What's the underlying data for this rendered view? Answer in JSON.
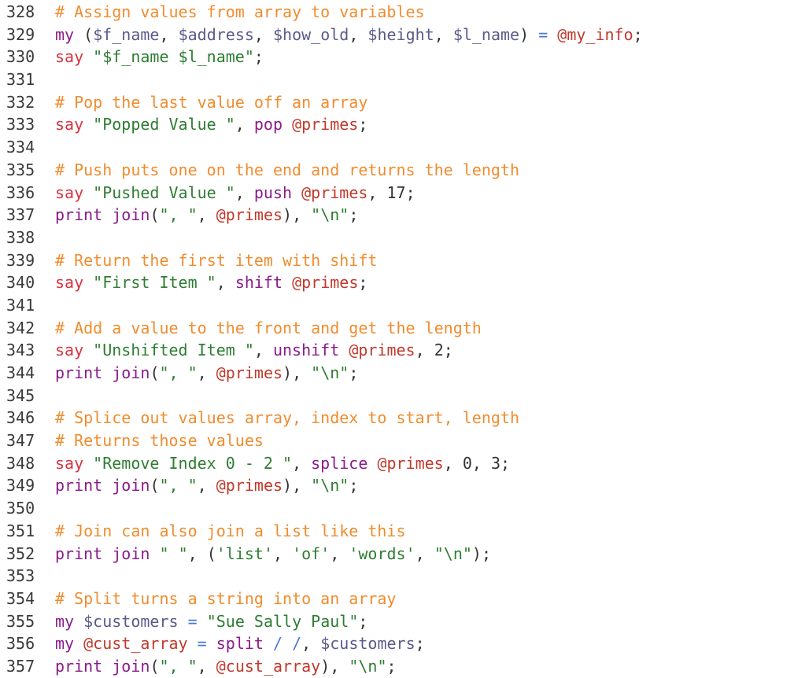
{
  "editor": {
    "lines": [
      {
        "number": "328",
        "tokens": [
          {
            "t": "comment",
            "v": "# Assign values from array to variables"
          }
        ]
      },
      {
        "number": "329",
        "tokens": [
          {
            "t": "keyword",
            "v": "my"
          },
          {
            "t": "plain",
            "v": " ("
          },
          {
            "t": "var",
            "v": "$f_name"
          },
          {
            "t": "plain",
            "v": ", "
          },
          {
            "t": "var",
            "v": "$address"
          },
          {
            "t": "plain",
            "v": ", "
          },
          {
            "t": "var",
            "v": "$how_old"
          },
          {
            "t": "plain",
            "v": ", "
          },
          {
            "t": "var",
            "v": "$height"
          },
          {
            "t": "plain",
            "v": ", "
          },
          {
            "t": "var",
            "v": "$l_name"
          },
          {
            "t": "plain",
            "v": ") "
          },
          {
            "t": "op",
            "v": "="
          },
          {
            "t": "plain",
            "v": " "
          },
          {
            "t": "array",
            "v": "@my_info"
          },
          {
            "t": "plain",
            "v": ";"
          }
        ]
      },
      {
        "number": "330",
        "tokens": [
          {
            "t": "say",
            "v": "say"
          },
          {
            "t": "plain",
            "v": " "
          },
          {
            "t": "string",
            "v": "\"$f_name $l_name\""
          },
          {
            "t": "plain",
            "v": ";"
          }
        ]
      },
      {
        "number": "331",
        "tokens": []
      },
      {
        "number": "332",
        "tokens": [
          {
            "t": "comment",
            "v": "# Pop the last value off an array"
          }
        ]
      },
      {
        "number": "333",
        "tokens": [
          {
            "t": "say",
            "v": "say"
          },
          {
            "t": "plain",
            "v": " "
          },
          {
            "t": "string",
            "v": "\"Popped Value \""
          },
          {
            "t": "plain",
            "v": ", "
          },
          {
            "t": "keyword",
            "v": "pop"
          },
          {
            "t": "plain",
            "v": " "
          },
          {
            "t": "array",
            "v": "@primes"
          },
          {
            "t": "plain",
            "v": ";"
          }
        ]
      },
      {
        "number": "334",
        "tokens": []
      },
      {
        "number": "335",
        "tokens": [
          {
            "t": "comment",
            "v": "# Push puts one on the end and returns the length"
          }
        ]
      },
      {
        "number": "336",
        "tokens": [
          {
            "t": "say",
            "v": "say"
          },
          {
            "t": "plain",
            "v": " "
          },
          {
            "t": "string",
            "v": "\"Pushed Value \""
          },
          {
            "t": "plain",
            "v": ", "
          },
          {
            "t": "keyword",
            "v": "push"
          },
          {
            "t": "plain",
            "v": " "
          },
          {
            "t": "array",
            "v": "@primes"
          },
          {
            "t": "plain",
            "v": ", "
          },
          {
            "t": "num",
            "v": "17"
          },
          {
            "t": "plain",
            "v": ";"
          }
        ]
      },
      {
        "number": "337",
        "tokens": [
          {
            "t": "keyword",
            "v": "print"
          },
          {
            "t": "plain",
            "v": " "
          },
          {
            "t": "keyword",
            "v": "join"
          },
          {
            "t": "plain",
            "v": "("
          },
          {
            "t": "string",
            "v": "\", \""
          },
          {
            "t": "plain",
            "v": ", "
          },
          {
            "t": "array",
            "v": "@primes"
          },
          {
            "t": "plain",
            "v": "), "
          },
          {
            "t": "string",
            "v": "\"\\n\""
          },
          {
            "t": "plain",
            "v": ";"
          }
        ]
      },
      {
        "number": "338",
        "tokens": []
      },
      {
        "number": "339",
        "tokens": [
          {
            "t": "comment",
            "v": "# Return the first item with shift"
          }
        ]
      },
      {
        "number": "340",
        "tokens": [
          {
            "t": "say",
            "v": "say"
          },
          {
            "t": "plain",
            "v": " "
          },
          {
            "t": "string",
            "v": "\"First Item \""
          },
          {
            "t": "plain",
            "v": ", "
          },
          {
            "t": "keyword",
            "v": "shift"
          },
          {
            "t": "plain",
            "v": " "
          },
          {
            "t": "array",
            "v": "@primes"
          },
          {
            "t": "plain",
            "v": ";"
          }
        ]
      },
      {
        "number": "341",
        "tokens": []
      },
      {
        "number": "342",
        "tokens": [
          {
            "t": "comment",
            "v": "# Add a value to the front and get the length"
          }
        ]
      },
      {
        "number": "343",
        "tokens": [
          {
            "t": "say",
            "v": "say"
          },
          {
            "t": "plain",
            "v": " "
          },
          {
            "t": "string",
            "v": "\"Unshifted Item \""
          },
          {
            "t": "plain",
            "v": ", "
          },
          {
            "t": "keyword",
            "v": "unshift"
          },
          {
            "t": "plain",
            "v": " "
          },
          {
            "t": "array",
            "v": "@primes"
          },
          {
            "t": "plain",
            "v": ", "
          },
          {
            "t": "num",
            "v": "2"
          },
          {
            "t": "plain",
            "v": ";"
          }
        ]
      },
      {
        "number": "344",
        "tokens": [
          {
            "t": "keyword",
            "v": "print"
          },
          {
            "t": "plain",
            "v": " "
          },
          {
            "t": "keyword",
            "v": "join"
          },
          {
            "t": "plain",
            "v": "("
          },
          {
            "t": "string",
            "v": "\", \""
          },
          {
            "t": "plain",
            "v": ", "
          },
          {
            "t": "array",
            "v": "@primes"
          },
          {
            "t": "plain",
            "v": "), "
          },
          {
            "t": "string",
            "v": "\"\\n\""
          },
          {
            "t": "plain",
            "v": ";"
          }
        ]
      },
      {
        "number": "345",
        "tokens": []
      },
      {
        "number": "346",
        "tokens": [
          {
            "t": "comment",
            "v": "# Splice out values array, index to start, length"
          }
        ]
      },
      {
        "number": "347",
        "tokens": [
          {
            "t": "comment",
            "v": "# Returns those values"
          }
        ]
      },
      {
        "number": "348",
        "tokens": [
          {
            "t": "say",
            "v": "say"
          },
          {
            "t": "plain",
            "v": " "
          },
          {
            "t": "string",
            "v": "\"Remove Index 0 - 2 \""
          },
          {
            "t": "plain",
            "v": ", "
          },
          {
            "t": "keyword",
            "v": "splice"
          },
          {
            "t": "plain",
            "v": " "
          },
          {
            "t": "array",
            "v": "@primes"
          },
          {
            "t": "plain",
            "v": ", "
          },
          {
            "t": "num",
            "v": "0"
          },
          {
            "t": "plain",
            "v": ", "
          },
          {
            "t": "num",
            "v": "3"
          },
          {
            "t": "plain",
            "v": ";"
          }
        ]
      },
      {
        "number": "349",
        "tokens": [
          {
            "t": "keyword",
            "v": "print"
          },
          {
            "t": "plain",
            "v": " "
          },
          {
            "t": "keyword",
            "v": "join"
          },
          {
            "t": "plain",
            "v": "("
          },
          {
            "t": "string",
            "v": "\", \""
          },
          {
            "t": "plain",
            "v": ", "
          },
          {
            "t": "array",
            "v": "@primes"
          },
          {
            "t": "plain",
            "v": "), "
          },
          {
            "t": "string",
            "v": "\"\\n\""
          },
          {
            "t": "plain",
            "v": ";"
          }
        ]
      },
      {
        "number": "350",
        "tokens": []
      },
      {
        "number": "351",
        "tokens": [
          {
            "t": "comment",
            "v": "# Join can also join a list like this"
          }
        ]
      },
      {
        "number": "352",
        "tokens": [
          {
            "t": "keyword",
            "v": "print"
          },
          {
            "t": "plain",
            "v": " "
          },
          {
            "t": "keyword",
            "v": "join"
          },
          {
            "t": "plain",
            "v": " "
          },
          {
            "t": "string",
            "v": "\" \""
          },
          {
            "t": "plain",
            "v": ", ("
          },
          {
            "t": "string",
            "v": "'list'"
          },
          {
            "t": "plain",
            "v": ", "
          },
          {
            "t": "string",
            "v": "'of'"
          },
          {
            "t": "plain",
            "v": ", "
          },
          {
            "t": "string",
            "v": "'words'"
          },
          {
            "t": "plain",
            "v": ", "
          },
          {
            "t": "string",
            "v": "\"\\n\""
          },
          {
            "t": "plain",
            "v": ");"
          }
        ]
      },
      {
        "number": "353",
        "tokens": []
      },
      {
        "number": "354",
        "tokens": [
          {
            "t": "comment",
            "v": "# Split turns a string into an array"
          }
        ]
      },
      {
        "number": "355",
        "tokens": [
          {
            "t": "keyword",
            "v": "my"
          },
          {
            "t": "plain",
            "v": " "
          },
          {
            "t": "var",
            "v": "$customers"
          },
          {
            "t": "plain",
            "v": " "
          },
          {
            "t": "op",
            "v": "="
          },
          {
            "t": "plain",
            "v": " "
          },
          {
            "t": "string",
            "v": "\"Sue Sally Paul\""
          },
          {
            "t": "plain",
            "v": ";"
          }
        ]
      },
      {
        "number": "356",
        "tokens": [
          {
            "t": "keyword",
            "v": "my"
          },
          {
            "t": "plain",
            "v": " "
          },
          {
            "t": "array",
            "v": "@cust_array"
          },
          {
            "t": "plain",
            "v": " "
          },
          {
            "t": "op",
            "v": "="
          },
          {
            "t": "plain",
            "v": " "
          },
          {
            "t": "keyword",
            "v": "split"
          },
          {
            "t": "plain",
            "v": " "
          },
          {
            "t": "op",
            "v": "/ /"
          },
          {
            "t": "plain",
            "v": ", "
          },
          {
            "t": "var",
            "v": "$customers"
          },
          {
            "t": "plain",
            "v": ";"
          }
        ]
      },
      {
        "number": "357",
        "tokens": [
          {
            "t": "keyword",
            "v": "print"
          },
          {
            "t": "plain",
            "v": " "
          },
          {
            "t": "keyword",
            "v": "join"
          },
          {
            "t": "plain",
            "v": "("
          },
          {
            "t": "string",
            "v": "\", \""
          },
          {
            "t": "plain",
            "v": ", "
          },
          {
            "t": "array",
            "v": "@cust_array"
          },
          {
            "t": "plain",
            "v": "), "
          },
          {
            "t": "string",
            "v": "\"\\n\""
          },
          {
            "t": "plain",
            "v": ";"
          }
        ]
      }
    ]
  }
}
